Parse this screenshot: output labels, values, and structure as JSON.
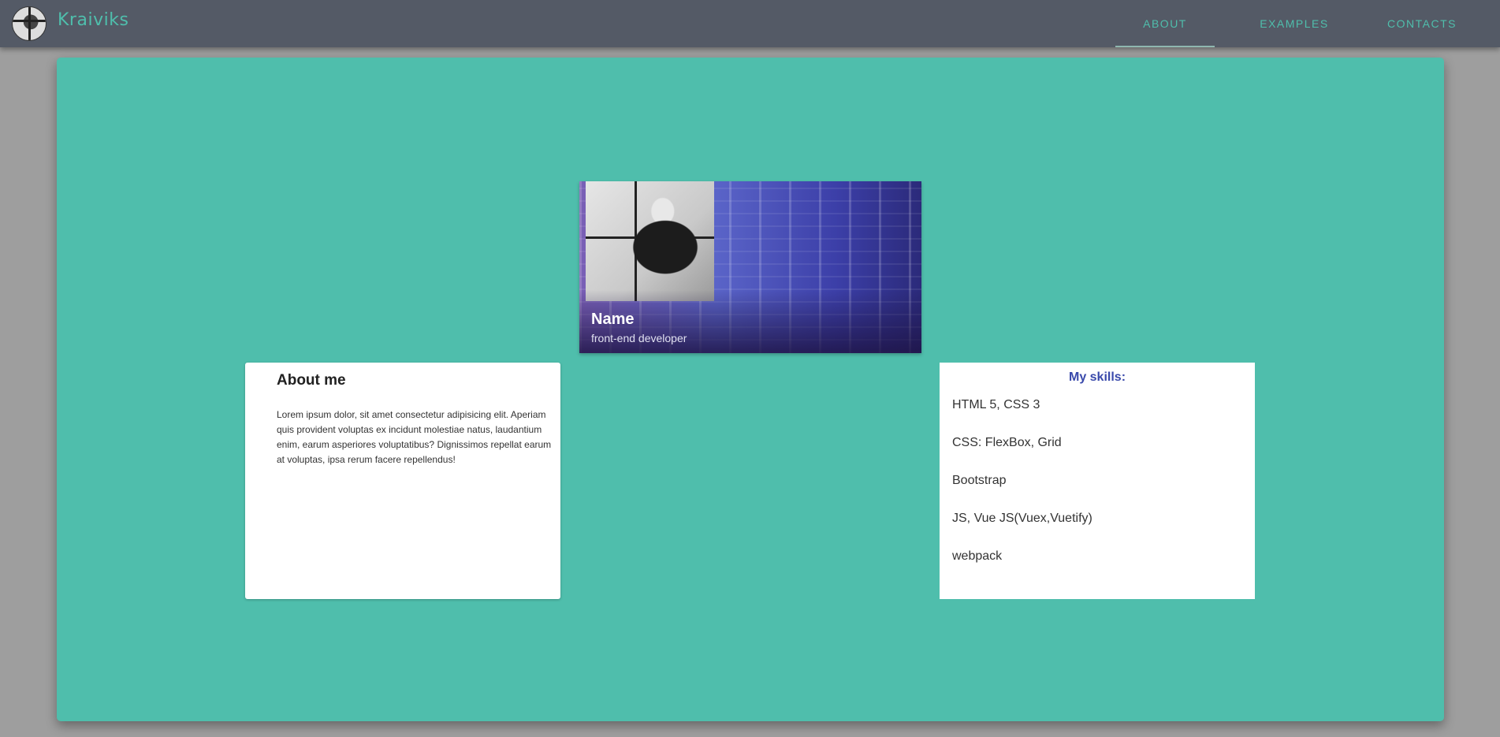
{
  "header": {
    "brand": "Kraiviks",
    "nav": [
      {
        "label": "ABOUT",
        "active": true
      },
      {
        "label": "EXAMPLES",
        "active": false
      },
      {
        "label": "CONTACTS",
        "active": false
      }
    ]
  },
  "profile": {
    "name": "Name",
    "role": "front-end developer"
  },
  "about": {
    "title": "About me",
    "text": "Lorem ipsum dolor, sit amet consectetur adipisicing elit. Aperiam quis provident voluptas ex incidunt molestiae natus, laudantium enim, earum asperiores voluptatibus? Dignissimos repellat earum at voluptas, ipsa rerum facere repellendus!"
  },
  "skills": {
    "title": "My skills:",
    "items": [
      "HTML 5, CSS 3",
      "CSS: FlexBox, Grid",
      "Bootstrap",
      "JS, Vue JS(Vuex,Vuetify)",
      "webpack"
    ]
  },
  "colors": {
    "accent": "#4fbeac",
    "appbar": "#545a66",
    "skills_title": "#3949ab"
  }
}
